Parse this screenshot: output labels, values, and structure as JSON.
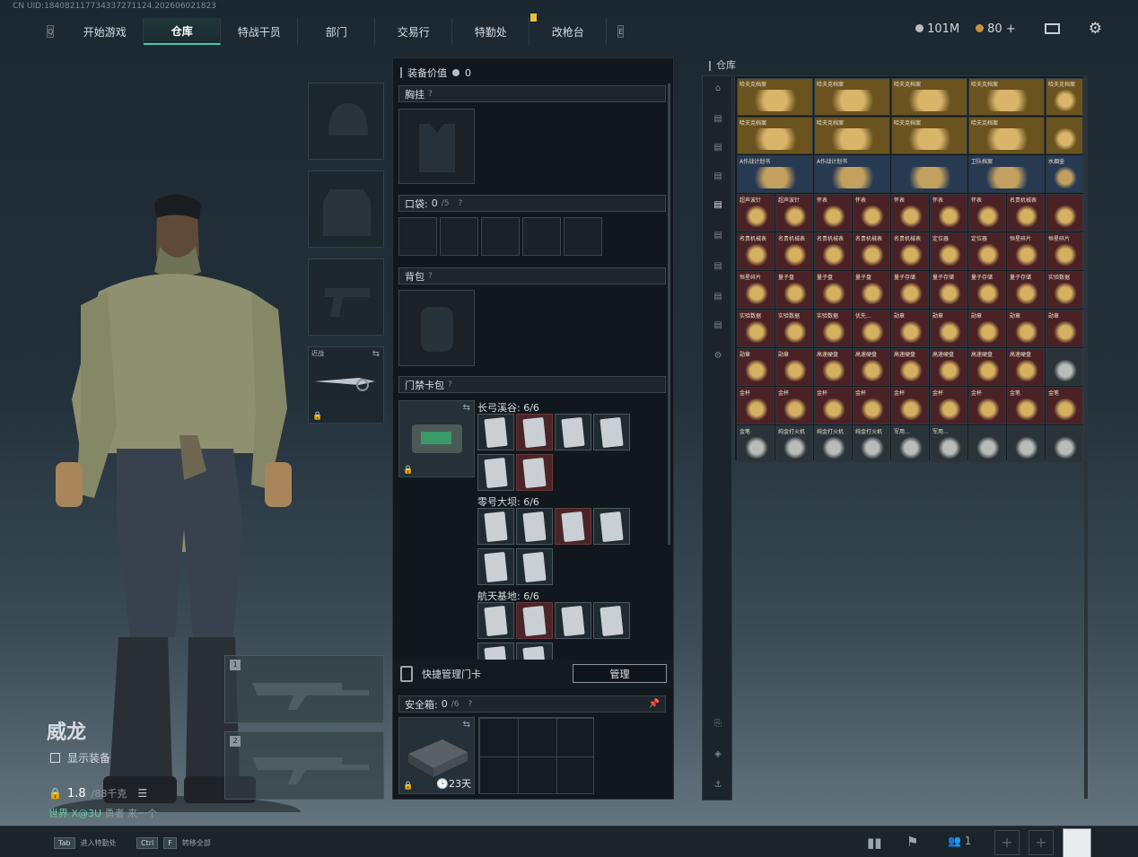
{
  "uid": "CN UID:184082117734337271124.202606021823",
  "nav": {
    "left_key": "Q",
    "right_key": "E",
    "tabs": [
      "开始游戏",
      "仓库",
      "特战干员",
      "部门",
      "交易行",
      "特勤处",
      "改枪台"
    ],
    "active_tab": "仓库"
  },
  "currency": {
    "silver": "101M",
    "gold": "80",
    "plus": "+"
  },
  "operator": {
    "name": "威龙",
    "show_equipment": "显示装备",
    "weight": "1.8",
    "weight_max": "/88千克",
    "subtitle_green": "世界 X@3U",
    "subtitle_rest": "勇者  来一个"
  },
  "weapon_slots": [
    "1",
    "2"
  ],
  "melee": {
    "label": "近战"
  },
  "equipment": {
    "value_label": "装备价值",
    "value": "0",
    "chest_label": "胸挂",
    "pocket_label": "口袋:",
    "pocket_count": "0",
    "pocket_max": "/5",
    "backpack_label": "背包",
    "keycard_label": "门禁卡包",
    "maps": [
      {
        "name": "长弓溪谷",
        "count": "6/6"
      },
      {
        "name": "零号大坝",
        "count": "6/6"
      },
      {
        "name": "航天基地",
        "count": "6/6"
      }
    ],
    "quick_manage": "快捷管理门卡",
    "manage_btn": "管理",
    "safe_label": "安全箱:",
    "safe_count": "0",
    "safe_max": "/6",
    "safe_days": "23天"
  },
  "stash": {
    "title": "仓库",
    "items": [
      {
        "name": "哈夫克档案",
        "c": "y"
      },
      {
        "name": "哈夫克档案",
        "c": "y"
      },
      {
        "name": "哈夫克档案",
        "c": "y"
      },
      {
        "name": "哈夫克档案",
        "c": "y"
      },
      {
        "name": "哈夫克档案",
        "c": "y"
      },
      {
        "name": "哈夫克档案",
        "c": "y"
      },
      {
        "name": "哈夫克档案",
        "c": "y"
      },
      {
        "name": "哈夫克档案",
        "c": "y"
      },
      {
        "name": "哈夫克档案",
        "c": "y"
      },
      {
        "name": "",
        "c": "y"
      },
      {
        "name": "A作战计划书",
        "c": "b"
      },
      {
        "name": "A作战计划书",
        "c": "b"
      },
      {
        "name": "",
        "c": "b"
      },
      {
        "name": "卫队档案",
        "c": "b"
      },
      {
        "name": "水烟壶",
        "c": "b"
      },
      {
        "name": "超声波针",
        "c": "r"
      },
      {
        "name": "超声波针",
        "c": "r"
      },
      {
        "name": "怀表",
        "c": "r"
      },
      {
        "name": "怀表",
        "c": "r"
      },
      {
        "name": "怀表",
        "c": "r"
      },
      {
        "name": "怀表",
        "c": "r"
      },
      {
        "name": "怀表",
        "c": "r"
      },
      {
        "name": "名贵机械表",
        "c": "r"
      },
      {
        "name": "",
        "c": "r"
      },
      {
        "name": "名贵机械表",
        "c": "r"
      },
      {
        "name": "名贵机械表",
        "c": "r"
      },
      {
        "name": "名贵机械表",
        "c": "r"
      },
      {
        "name": "名贵机械表",
        "c": "r"
      },
      {
        "name": "名贵机械表",
        "c": "r"
      },
      {
        "name": "定位器",
        "c": "r"
      },
      {
        "name": "定位器",
        "c": "r"
      },
      {
        "name": "恒星碎片",
        "c": "r"
      },
      {
        "name": "恒星碎片",
        "c": "r"
      },
      {
        "name": "恒星碎片",
        "c": "r"
      },
      {
        "name": "量子盘",
        "c": "r"
      },
      {
        "name": "量子盘",
        "c": "r"
      },
      {
        "name": "量子盘",
        "c": "r"
      },
      {
        "name": "量子存储",
        "c": "r"
      },
      {
        "name": "量子存储",
        "c": "r"
      },
      {
        "name": "量子存储",
        "c": "r"
      },
      {
        "name": "量子存储",
        "c": "r"
      },
      {
        "name": "实验数据",
        "c": "r"
      },
      {
        "name": "实验数据",
        "c": "r"
      },
      {
        "name": "实验数据",
        "c": "r"
      },
      {
        "name": "实验数据",
        "c": "r"
      },
      {
        "name": "优先...",
        "c": "r"
      },
      {
        "name": "勋章",
        "c": "r"
      },
      {
        "name": "勋章",
        "c": "r"
      },
      {
        "name": "勋章",
        "c": "r"
      },
      {
        "name": "勋章",
        "c": "r"
      },
      {
        "name": "勋章",
        "c": "r"
      },
      {
        "name": "勋章",
        "c": "r"
      },
      {
        "name": "勋章",
        "c": "r"
      },
      {
        "name": "高速硬盘",
        "c": "r"
      },
      {
        "name": "高速硬盘",
        "c": "r"
      },
      {
        "name": "高速硬盘",
        "c": "r"
      },
      {
        "name": "高速硬盘",
        "c": "r"
      },
      {
        "name": "高速硬盘",
        "c": "r"
      },
      {
        "name": "高速硬盘",
        "c": "r"
      },
      {
        "name": "",
        "c": "g"
      },
      {
        "name": "金杯",
        "c": "r"
      },
      {
        "name": "金杯",
        "c": "r"
      },
      {
        "name": "金杯",
        "c": "r"
      },
      {
        "name": "金杯",
        "c": "r"
      },
      {
        "name": "金杯",
        "c": "r"
      },
      {
        "name": "金杯",
        "c": "r"
      },
      {
        "name": "金杯",
        "c": "r"
      },
      {
        "name": "金笔",
        "c": "r"
      },
      {
        "name": "金笔",
        "c": "r"
      },
      {
        "name": "金笔",
        "c": "g"
      },
      {
        "name": "纯金打火机",
        "c": "g"
      },
      {
        "name": "纯金打火机",
        "c": "g"
      },
      {
        "name": "纯金打火机",
        "c": "g"
      },
      {
        "name": "军用...",
        "c": "g"
      },
      {
        "name": "军用...",
        "c": "g"
      },
      {
        "name": "",
        "c": "g"
      },
      {
        "name": "",
        "c": "g"
      },
      {
        "name": "",
        "c": "g"
      }
    ]
  },
  "bottom": {
    "k1": "Tab",
    "k1_label": "进入特勤处",
    "k2": "Ctrl",
    "k2b": "F",
    "k2_label": "转移全部",
    "friends": "1"
  }
}
